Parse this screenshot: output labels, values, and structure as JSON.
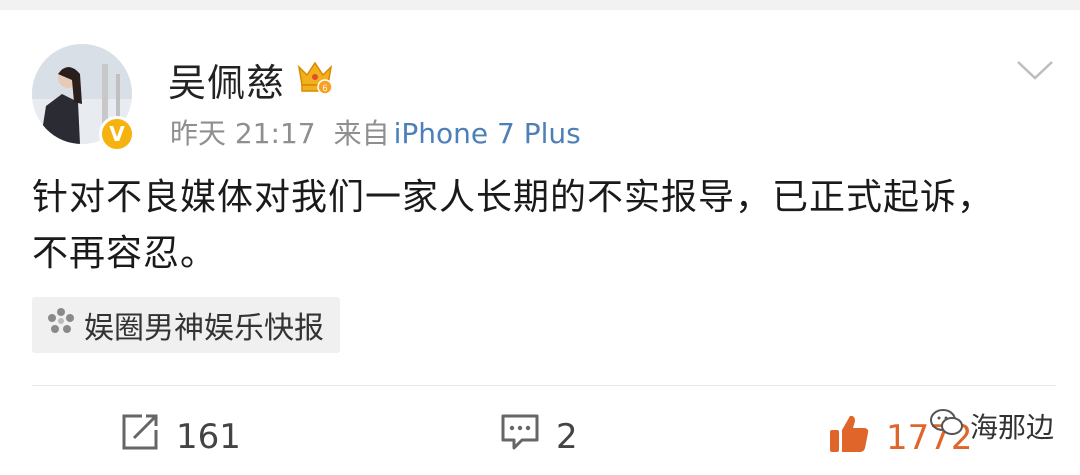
{
  "post": {
    "username": "吴佩慈",
    "crown_level": "6",
    "timestamp": "昨天 21:17",
    "source_prefix": "来自",
    "device": "iPhone 7 Plus",
    "content_line1": "针对不良媒体对我们一家人长期的不实报导，已正式起诉，",
    "content_line2": "不再容忍。",
    "topic": "娱圈男神娱乐快报"
  },
  "actions": {
    "repost_count": "161",
    "comment_count": "2",
    "like_count": "1772"
  },
  "watermark": {
    "text": "海那边"
  },
  "colors": {
    "accent_orange": "#e0652a",
    "link_blue": "#4d7fb8",
    "verified_gold": "#f6b20f"
  }
}
